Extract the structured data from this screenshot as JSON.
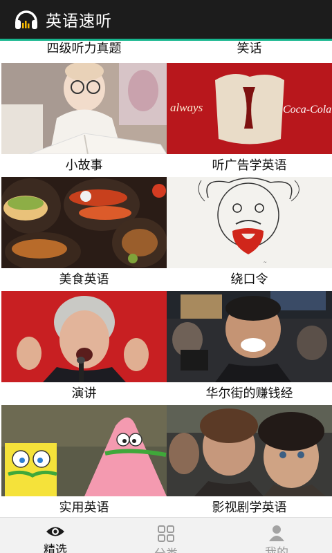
{
  "app": {
    "title": "英语速听"
  },
  "categories": [
    {
      "label": "四级听力真题",
      "image": "exam-thumbnail"
    },
    {
      "label": "笑话",
      "image": "joke-thumbnail"
    },
    {
      "label": "小故事",
      "image": "baby-reading-photo"
    },
    {
      "label": "听广告学英语",
      "image": "advertisement-photo",
      "image_text": {
        "left_brand": "always",
        "right_brand": "Coca-Cola"
      }
    },
    {
      "label": "美食英语",
      "image": "mexican-food-photo"
    },
    {
      "label": "绕口令",
      "image": "einstein-tongue-sketch"
    },
    {
      "label": "演讲",
      "image": "speech-photo"
    },
    {
      "label": "华尔街的赚钱经",
      "image": "wall-street-photo"
    },
    {
      "label": "实用英语",
      "image": "cartoon-photo"
    },
    {
      "label": "影视剧学英语",
      "image": "movie-still-photo"
    }
  ],
  "tabs": [
    {
      "label": "精选",
      "icon": "eye-icon",
      "active": true
    },
    {
      "label": "分类",
      "icon": "category-icon",
      "active": false
    },
    {
      "label": "我的",
      "icon": "user-icon",
      "active": false
    }
  ],
  "colors": {
    "header": "#1c1c1c",
    "accent": "#16b68e",
    "tabbar": "#f2f2f2"
  }
}
